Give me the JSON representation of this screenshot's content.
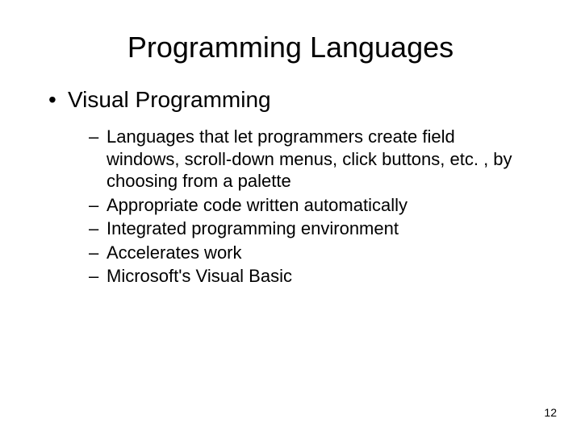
{
  "title": "Programming Languages",
  "bullet": {
    "label": "Visual Programming",
    "subitems": [
      "Languages that let programmers create field windows, scroll-down menus, click buttons, etc. , by choosing from a palette",
      "Appropriate code written automatically",
      "Integrated programming environment",
      "Accelerates work",
      "Microsoft's Visual Basic"
    ]
  },
  "pageNumber": "12"
}
